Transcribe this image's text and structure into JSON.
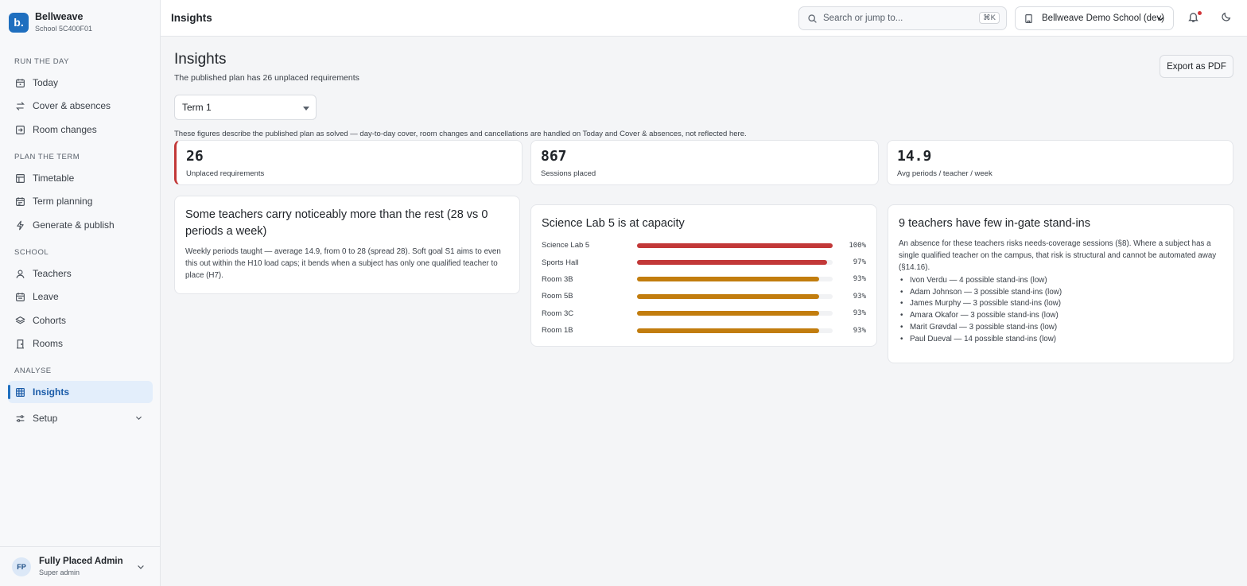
{
  "brand": {
    "logo": "b.",
    "name": "Bellweave",
    "school_code": "School 5C400F01"
  },
  "sidebar": {
    "sections": [
      {
        "label": "RUN THE DAY",
        "items": [
          {
            "label": "Today",
            "icon": "calendar-icon"
          },
          {
            "label": "Cover & absences",
            "icon": "swap-icon"
          },
          {
            "label": "Room changes",
            "icon": "door-enter-icon"
          }
        ]
      },
      {
        "label": "PLAN THE TERM",
        "items": [
          {
            "label": "Timetable",
            "icon": "grid-icon"
          },
          {
            "label": "Term planning",
            "icon": "calendar-range-icon"
          },
          {
            "label": "Generate & publish",
            "icon": "bolt-icon"
          }
        ]
      },
      {
        "label": "SCHOOL",
        "items": [
          {
            "label": "Teachers",
            "icon": "user-icon"
          },
          {
            "label": "Leave",
            "icon": "calendar-leave-icon"
          },
          {
            "label": "Cohorts",
            "icon": "layers-icon"
          },
          {
            "label": "Rooms",
            "icon": "building-icon"
          }
        ]
      },
      {
        "label": "ANALYSE",
        "items": [
          {
            "label": "Insights",
            "icon": "table-icon",
            "active": true
          }
        ]
      }
    ],
    "setup_label": "Setup"
  },
  "user": {
    "initials": "FP",
    "name": "Fully Placed Admin",
    "role": "Super admin"
  },
  "topbar": {
    "title": "Insights",
    "search_placeholder": "Search or jump to...",
    "search_shortcut": "⌘K",
    "school_selector": "Bellweave Demo School (dev)"
  },
  "page": {
    "title": "Insights",
    "subtitle": "The published plan has 26 unplaced requirements",
    "export_label": "Export as PDF",
    "term_select": "Term 1",
    "disclaimer": "These figures describe the published plan as solved — day-to-day cover, room changes and cancellations are handled on Today and Cover & absences, not reflected here."
  },
  "stats": [
    {
      "value": "26",
      "label": "Unplaced requirements"
    },
    {
      "value": "867",
      "label": "Sessions placed"
    },
    {
      "value": "14.9",
      "label": "Avg periods / teacher / week"
    }
  ],
  "load_card": {
    "title": "Some teachers carry noticeably more than the rest (28 vs 0 periods a week)",
    "body": "Weekly periods taught — average 14.9, from 0 to 28 (spread 28). Soft goal S1 aims to even this out within the H10 load caps; it bends when a subject has only one qualified teacher to place (H7)."
  },
  "capacity_card": {
    "title": "Science Lab 5 is at capacity",
    "rooms": [
      {
        "name": "Science Lab 5",
        "utilization": 1.0,
        "label": "100%",
        "color": "#c23838"
      },
      {
        "name": "Sports Hall",
        "utilization": 0.97,
        "label": "97%",
        "color": "#c23838"
      },
      {
        "name": "Room 3B",
        "utilization": 0.93,
        "label": "93%",
        "color": "#c27d0e"
      },
      {
        "name": "Room 5B",
        "utilization": 0.93,
        "label": "93%",
        "color": "#c27d0e"
      },
      {
        "name": "Room 3C",
        "utilization": 0.93,
        "label": "93%",
        "color": "#c27d0e"
      },
      {
        "name": "Room 1B",
        "utilization": 0.93,
        "label": "93%",
        "color": "#c27d0e"
      }
    ]
  },
  "standin_card": {
    "title": "9 teachers have few in-gate stand-ins",
    "body": "An absence for these teachers risks needs-coverage sessions (§8). Where a subject has a single qualified teacher on the campus, that risk is structural and cannot be automated away (§14.16).",
    "items": [
      "Ivon Verdu — 4 possible stand-ins (low)",
      "Adam Johnson — 3 possible stand-ins (low)",
      "James Murphy — 3 possible stand-ins (low)",
      "Amara Okafor — 3 possible stand-ins (low)",
      "Marit Grøvdal — 3 possible stand-ins (low)",
      "Paul Dueval — 14 possible stand-ins (low)"
    ]
  }
}
